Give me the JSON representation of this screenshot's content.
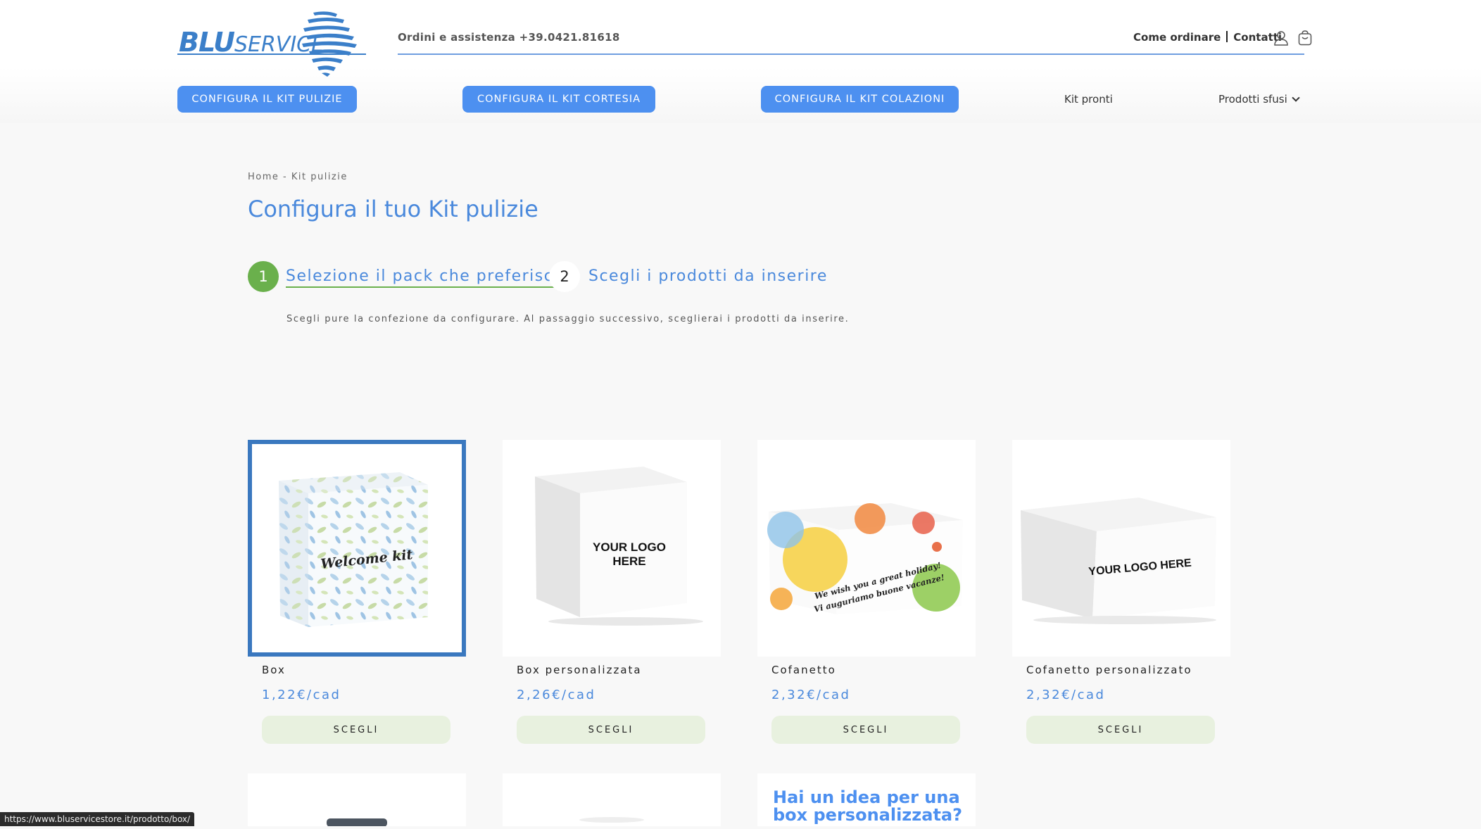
{
  "brand": {
    "name_bold": "BLU",
    "name_rest": "SERVICE",
    "color": "#3b7fc9"
  },
  "header": {
    "phone": "Ordini e assistenza +39.0421.81618",
    "links": [
      "Come ordinare",
      "Contatti"
    ],
    "icons": [
      "user-icon",
      "cart-icon"
    ]
  },
  "nav": {
    "buttons": [
      "CONFIGURA IL KIT PULIZIE",
      "CONFIGURA IL KIT CORTESIA",
      "CONFIGURA IL KIT COLAZIONI"
    ],
    "links": [
      "Kit pronti",
      "Prodotti sfusi"
    ]
  },
  "breadcrumb": "Home - Kit pulizie",
  "title": "Configura il tuo Kit pulizie",
  "steps": [
    {
      "number": "1",
      "label": "Selezione il pack che preferisci",
      "active": true
    },
    {
      "number": "2",
      "label": "Scegli i prodotti da inserire",
      "active": false
    }
  ],
  "step_description": "Scegli pure la confezione da configurare. Al passaggio successivo, sceglierai i prodotti da inserire.",
  "products": [
    {
      "name": "Box",
      "price": "1,22€/cad",
      "button": "SCEGLI",
      "selected": true,
      "image_text": "Welcome kit"
    },
    {
      "name": "Box personalizzata",
      "price": "2,26€/cad",
      "button": "SCEGLI",
      "selected": false,
      "image_text_1": "YOUR LOGO",
      "image_text_2": "HERE"
    },
    {
      "name": "Cofanetto",
      "price": "2,32€/cad",
      "button": "SCEGLI",
      "selected": false,
      "image_text_1": "We wish you a great holiday!",
      "image_text_2": "Vi auguriamo buone vacanze!"
    },
    {
      "name": "Cofanetto personalizzato",
      "price": "2,32€/cad",
      "button": "SCEGLI",
      "selected": false,
      "image_text": "YOUR LOGO HERE"
    }
  ],
  "promo": {
    "line1": "Hai un idea per una",
    "line2": "box personalizzata?"
  },
  "colors": {
    "accent": "#4d90f0",
    "step_active": "#6ab04c",
    "selected_border": "#3a78bf",
    "button_bg": "#e8f1df"
  },
  "status_url": "https://www.bluservicestore.it/prodotto/box/"
}
